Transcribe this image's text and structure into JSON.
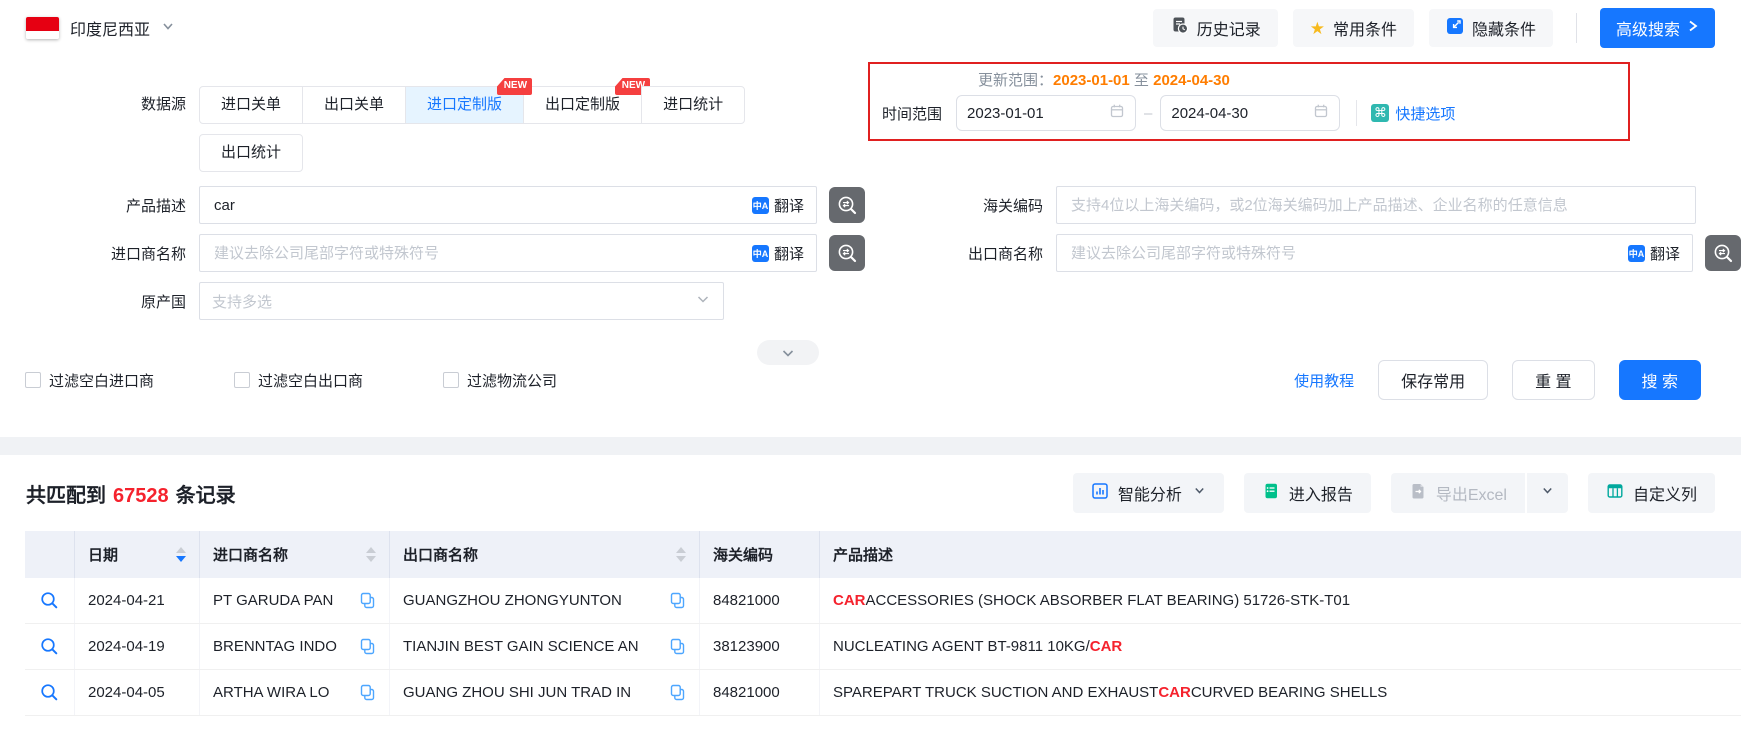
{
  "topbar": {
    "country": "印度尼西亚",
    "history_label": "历史记录",
    "favorites_label": "常用条件",
    "hide_label": "隐藏条件",
    "advanced_label": "高级搜索"
  },
  "search": {
    "datasource_label": "数据源",
    "tabs": [
      {
        "label": "进口关单",
        "active": false
      },
      {
        "label": "出口关单",
        "active": false
      },
      {
        "label": "进口定制版",
        "active": true,
        "badge": "NEW"
      },
      {
        "label": "出口定制版",
        "active": false,
        "badge": "NEW"
      },
      {
        "label": "进口统计",
        "active": false
      },
      {
        "label": "出口统计",
        "active": false
      }
    ],
    "update_range": {
      "label": "更新范围：",
      "from": "2023-01-01",
      "separator": "至",
      "to": "2024-04-30"
    },
    "time_range": {
      "label": "时间范围",
      "from": "2023-01-01",
      "to": "2024-04-30",
      "quick_label": "快捷选项"
    },
    "product": {
      "label": "产品描述",
      "value": "car",
      "translate_label": "翻译"
    },
    "hs_code": {
      "label": "海关编码",
      "placeholder": "支持4位以上海关编码，或2位海关编码加上产品描述、企业名称的任意信息"
    },
    "importer": {
      "label": "进口商名称",
      "placeholder": "建议去除公司尾部字符或特殊符号",
      "translate_label": "翻译"
    },
    "exporter": {
      "label": "出口商名称",
      "placeholder": "建议去除公司尾部字符或特殊符号",
      "translate_label": "翻译"
    },
    "origin": {
      "label": "原产国",
      "placeholder": "支持多选"
    },
    "filters": [
      "过滤空白进口商",
      "过滤空白出口商",
      "过滤物流公司"
    ],
    "tutorial_label": "使用教程",
    "save_label": "保存常用",
    "reset_label": "重 置",
    "search_label": "搜 索"
  },
  "results": {
    "count_prefix": "共匹配到",
    "count": "67528",
    "count_suffix": "条记录",
    "actions": {
      "analyze_label": "智能分析",
      "report_label": "进入报告",
      "export_label": "导出Excel",
      "columns_label": "自定义列"
    },
    "table": {
      "headers": [
        "日期",
        "进口商名称",
        "出口商名称",
        "海关编码",
        "产品描述"
      ],
      "rows": [
        {
          "date": "2024-04-21",
          "importer": "PT GARUDA PAN",
          "exporter": "GUANGZHOU ZHONGYUNTON",
          "hs_code": "84821000",
          "description": [
            {
              "text": "CAR",
              "highlight": true
            },
            {
              "text": " ACCESSORIES (SHOCK ABSORBER FLAT BEARING) 51726-STK-T01",
              "highlight": false
            }
          ]
        },
        {
          "date": "2024-04-19",
          "importer": "BRENNTAG INDO",
          "exporter": "TIANJIN BEST GAIN SCIENCE AN",
          "hs_code": "38123900",
          "description": [
            {
              "text": "NUCLEATING AGENT BT-9811 10KG/",
              "highlight": false
            },
            {
              "text": "CAR",
              "highlight": true
            }
          ]
        },
        {
          "date": "2024-04-05",
          "importer": "ARTHA WIRA LO",
          "exporter": "GUANG ZHOU SHI JUN TRAD IN",
          "hs_code": "84821000",
          "description": [
            {
              "text": "SPAREPART TRUCK SUCTION AND EXHAUST ",
              "highlight": false
            },
            {
              "text": "CAR",
              "highlight": true
            },
            {
              "text": " CURVED BEARING SHELLS",
              "highlight": false
            }
          ]
        }
      ]
    }
  },
  "colors": {
    "primary_blue": "#1677ff",
    "highlight_red": "#f5222d",
    "date_orange": "#ff7d00",
    "badge_red": "#f53f3f",
    "quick_teal": "#2fb8b0",
    "report_green": "#00c08b",
    "columns_teal": "#00a89d",
    "star_gold": "#f7ba1e",
    "red_box_border": "#e02020"
  }
}
